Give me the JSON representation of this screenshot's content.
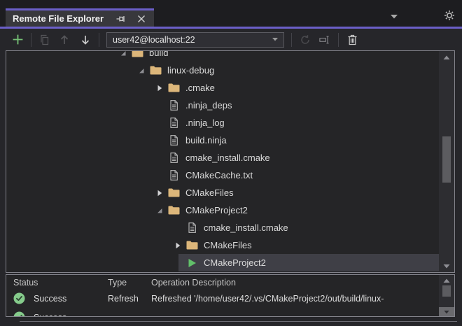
{
  "window": {
    "title": "Remote File Explorer"
  },
  "toolbar": {
    "connection_value": "user42@localhost:22"
  },
  "tree": {
    "items": [
      {
        "label": "build",
        "icon": "folder",
        "expander": "expanded",
        "indent": 158,
        "selected": false
      },
      {
        "label": "linux-debug",
        "icon": "folder",
        "expander": "expanded",
        "indent": 184,
        "selected": false
      },
      {
        "label": ".cmake",
        "icon": "folder",
        "expander": "collapsed",
        "indent": 210,
        "selected": false
      },
      {
        "label": ".ninja_deps",
        "icon": "file",
        "expander": "none",
        "indent": 210,
        "selected": false
      },
      {
        "label": ".ninja_log",
        "icon": "file",
        "expander": "none",
        "indent": 210,
        "selected": false
      },
      {
        "label": "build.ninja",
        "icon": "file",
        "expander": "none",
        "indent": 210,
        "selected": false
      },
      {
        "label": "cmake_install.cmake",
        "icon": "file",
        "expander": "none",
        "indent": 210,
        "selected": false
      },
      {
        "label": "CMakeCache.txt",
        "icon": "file",
        "expander": "none",
        "indent": 210,
        "selected": false
      },
      {
        "label": "CMakeFiles",
        "icon": "folder",
        "expander": "collapsed",
        "indent": 210,
        "selected": false
      },
      {
        "label": "CMakeProject2",
        "icon": "folder",
        "expander": "expanded",
        "indent": 210,
        "selected": false
      },
      {
        "label": "cmake_install.cmake",
        "icon": "file",
        "expander": "none",
        "indent": 236,
        "selected": false
      },
      {
        "label": "CMakeFiles",
        "icon": "folder",
        "expander": "collapsed",
        "indent": 236,
        "selected": false
      },
      {
        "label": "CMakeProject2",
        "icon": "run",
        "expander": "none",
        "indent": 236,
        "selected": true
      }
    ]
  },
  "operations": {
    "columns": [
      "Status",
      "Type",
      "Operation Description"
    ],
    "rows": [
      {
        "status": "Success",
        "type": "Refresh",
        "description": "Refreshed '/home/user42/.vs/CMakeProject2/out/build/linux-"
      },
      {
        "status": "Success",
        "type": "",
        "description": ""
      }
    ]
  },
  "colors": {
    "accent": "#6b5fc8",
    "folder": "#dcb67a",
    "success_green": "#85cb8b",
    "run_green": "#62c06a",
    "add_green": "#75c175",
    "selection": "#3f3f46"
  }
}
